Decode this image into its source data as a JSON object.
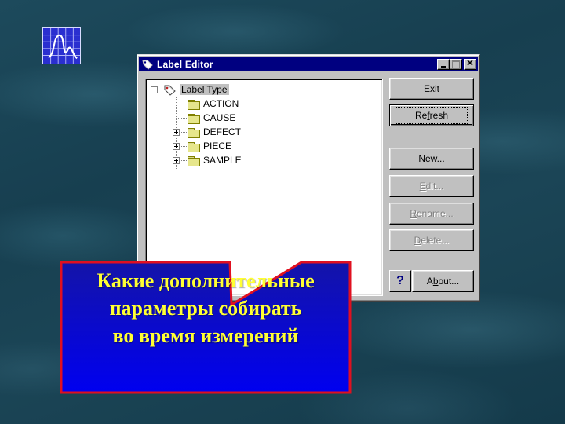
{
  "logo": {
    "icon": "waveform-chart-icon"
  },
  "window": {
    "title": "Label Editor",
    "title_icon": "label-tag-icon",
    "controls": {
      "minimize": "minimize",
      "maximize": "maximize",
      "close": "close"
    }
  },
  "tree": {
    "root": {
      "label": "Label Type",
      "expanded": true,
      "icon": "label-tag-icon"
    },
    "children": [
      {
        "label": "ACTION",
        "expandable": false,
        "icon": "folder-icon"
      },
      {
        "label": "CAUSE",
        "expandable": false,
        "icon": "folder-icon"
      },
      {
        "label": "DEFECT",
        "expandable": true,
        "icon": "folder-icon"
      },
      {
        "label": "PIECE",
        "expandable": true,
        "icon": "folder-icon"
      },
      {
        "label": "SAMPLE",
        "expandable": true,
        "icon": "folder-icon"
      }
    ]
  },
  "buttons": {
    "exit": {
      "pre": "E",
      "accel": "x",
      "post": "it",
      "enabled": true
    },
    "refresh": {
      "pre": "Re",
      "accel": "f",
      "post": "resh",
      "enabled": true,
      "default": true
    },
    "new": {
      "pre": "",
      "accel": "N",
      "post": "ew...",
      "enabled": true
    },
    "edit": {
      "pre": "",
      "accel": "E",
      "post": "dit...",
      "enabled": false
    },
    "rename": {
      "pre": "",
      "accel": "R",
      "post": "ename...",
      "enabled": false
    },
    "delete": {
      "pre": "",
      "accel": "D",
      "post": "elete...",
      "enabled": false
    },
    "help": {
      "label": "?"
    },
    "about": {
      "pre": "A",
      "accel": "b",
      "post": "out...",
      "enabled": true
    }
  },
  "callout": {
    "lines": [
      "Какие дополнительные",
      "параметры собирать",
      "во время измерений"
    ],
    "colors": {
      "fill_top": "#1010a0",
      "fill_bottom": "#0000ee",
      "border": "#e01020",
      "text": "#ffff33"
    }
  }
}
